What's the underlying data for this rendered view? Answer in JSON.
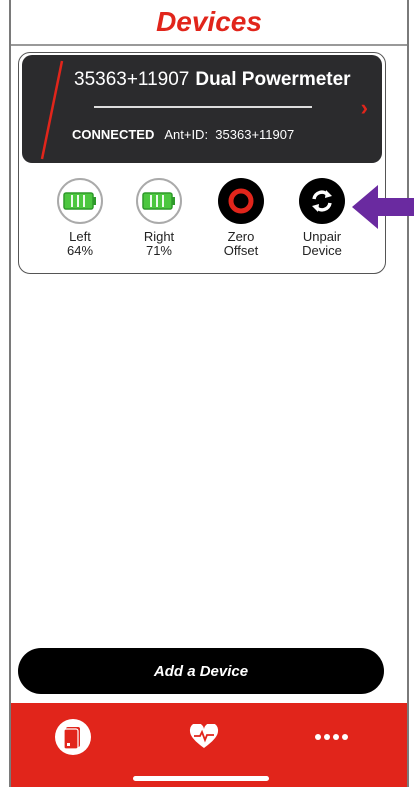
{
  "header": {
    "title": "Devices"
  },
  "device": {
    "id": "35363+11907",
    "model": "Dual Powermeter",
    "status": "CONNECTED",
    "ant_label": "Ant+ID:",
    "ant_id": "35363+11907"
  },
  "actions": [
    {
      "label_1": "Left",
      "label_2": "64%",
      "icon": "battery-icon",
      "level": 0.64
    },
    {
      "label_1": "Right",
      "label_2": "71%",
      "icon": "battery-icon",
      "level": 0.71
    },
    {
      "label_1": "Zero",
      "label_2": "Offset",
      "icon": "zero-offset-icon"
    },
    {
      "label_1": "Unpair",
      "label_2": "Device",
      "icon": "unpair-sync-icon"
    }
  ],
  "add_button": {
    "label": "Add a Device"
  },
  "tabs": [
    {
      "icon": "devices-tab-icon"
    },
    {
      "icon": "heart-rate-icon"
    },
    {
      "icon": "more-dots-icon"
    }
  ],
  "colors": {
    "accent": "#e1251b",
    "panel": "#2b2b2d",
    "battery": "#4cc73f",
    "arrow": "#6a2aa0"
  }
}
